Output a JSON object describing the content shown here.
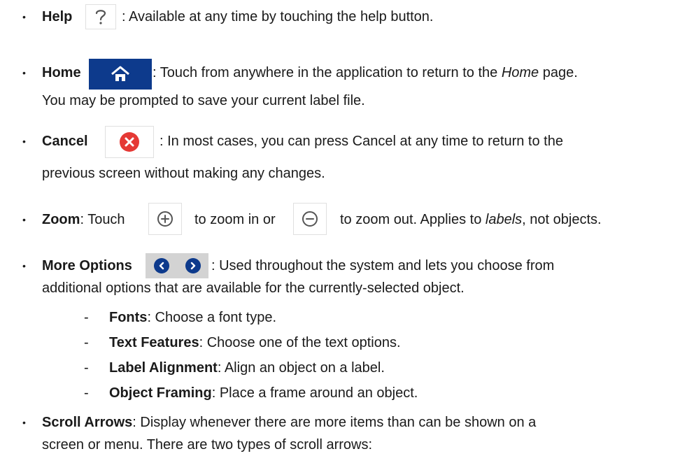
{
  "items": {
    "help": {
      "label": "Help",
      "text": ": Available at any time by touching the help button.",
      "icon": "question-mark-icon"
    },
    "home": {
      "label": "Home",
      "text_a": ": Touch from anywhere in the application to return to the ",
      "text_em": "Home",
      "text_b": " page.",
      "text_line2": "You may be prompted to save your current label file.",
      "icon": "home-icon"
    },
    "cancel": {
      "label": "Cancel",
      "text": ": In most cases, you can press Cancel at any time to return to the",
      "text_line2": "previous screen without making any changes.",
      "icon": "cancel-x-icon",
      "icon_color": "#e53935"
    },
    "zoom": {
      "label": "Zoom",
      "text_a": ": Touch",
      "text_b": "to zoom in or",
      "text_c": "to zoom out. Applies to ",
      "text_em": "labels",
      "text_d": ", not objects.",
      "icons": [
        "zoom-in-icon",
        "zoom-out-icon"
      ]
    },
    "more_options": {
      "label": "More Options",
      "text": ": Used throughout the system and lets you choose from",
      "text_line2": "additional options that are available for the currently-selected object.",
      "icons": [
        "chevron-left-icon",
        "chevron-right-icon"
      ],
      "sub": [
        {
          "label": "Fonts",
          "text": ": Choose a font type."
        },
        {
          "label": "Text Features",
          "text": ": Choose one of the text options."
        },
        {
          "label": "Label Alignment",
          "text": ": Align an object on a label."
        },
        {
          "label": "Object Framing",
          "text": ": Place a frame around an object."
        }
      ]
    },
    "scroll": {
      "label": "Scroll Arrows",
      "text": ": Display whenever there are more items than can be shown on a",
      "text_line2": "screen or menu. There are two types of scroll arrows:"
    }
  },
  "bullet_char": "•",
  "dash_char": "-",
  "colors": {
    "accent": "#0d3a8c",
    "cancel_red": "#e53935",
    "chevron_bg": "#d3d3d3"
  }
}
